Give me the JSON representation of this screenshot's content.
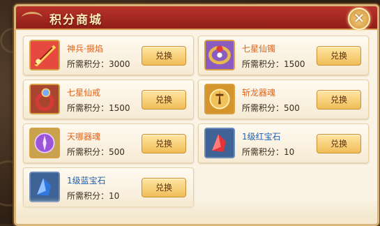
{
  "window": {
    "title": "积分商城",
    "close_label": "✕"
  },
  "colors": {
    "title_bg": "#a62a22",
    "orange_name": "#e2641a",
    "blue_name": "#1f5fb3",
    "button_bg": "#f0bd58"
  },
  "items": [
    {
      "name": "神兵·摄焰",
      "cost": "所需积分：3000",
      "button": "兑换",
      "name_color": "orange",
      "icon": "divine-weapon-icon"
    },
    {
      "name": "七星仙镯",
      "cost": "所需积分：1500",
      "button": "兑换",
      "name_color": "orange",
      "icon": "bracelet-icon"
    },
    {
      "name": "七星仙戒",
      "cost": "所需积分：1500",
      "button": "兑换",
      "name_color": "orange",
      "icon": "ring-icon"
    },
    {
      "name": "斩龙器魂",
      "cost": "所需积分：500",
      "button": "兑换",
      "name_color": "orange",
      "icon": "orange-soul-orb-icon"
    },
    {
      "name": "天哪器魂",
      "cost": "所需积分：500",
      "button": "兑换",
      "name_color": "orange",
      "icon": "purple-soul-orb-icon"
    },
    {
      "name": "1级红宝石",
      "cost": "所需积分：10",
      "button": "兑换",
      "name_color": "blue",
      "icon": "red-gem-icon"
    },
    {
      "name": "1级蓝宝石",
      "cost": "所需积分：10",
      "button": "兑换",
      "name_color": "blue",
      "icon": "blue-gem-icon"
    }
  ]
}
